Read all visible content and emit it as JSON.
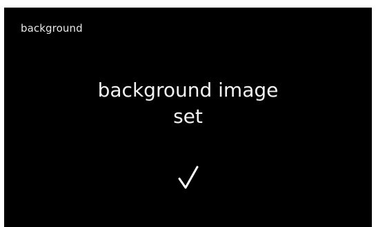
{
  "header": {
    "title": "background"
  },
  "message": {
    "line1": "background image",
    "line2": "set"
  },
  "confirmation": {
    "icon": "checkmark-icon",
    "color": "#ffffff"
  },
  "colors": {
    "background": "#000000",
    "text": "#f2f2f2"
  }
}
